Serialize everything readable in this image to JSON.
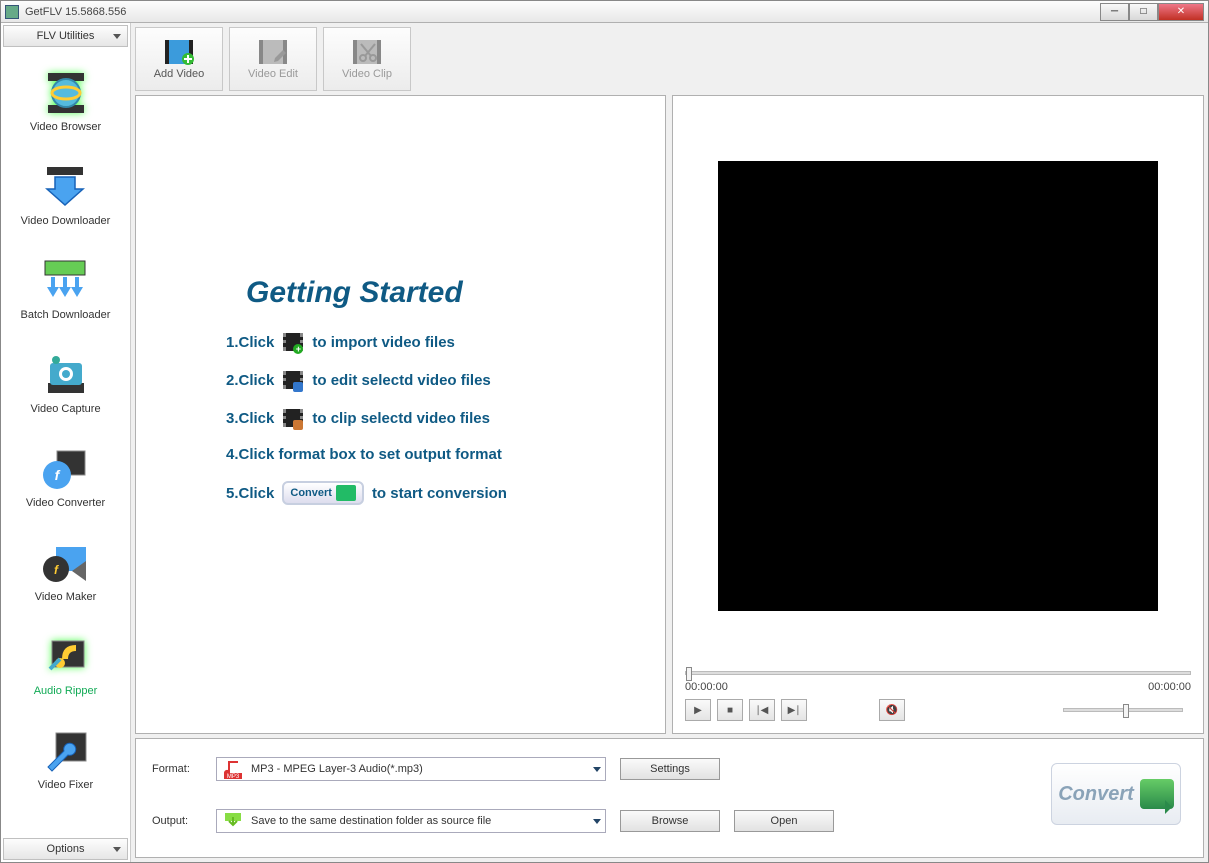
{
  "window": {
    "title": "GetFLV 15.5868.556"
  },
  "sidebar": {
    "header": "FLV Utilities",
    "footer": "Options",
    "items": [
      {
        "label": "Video Browser"
      },
      {
        "label": "Video Downloader"
      },
      {
        "label": "Batch Downloader"
      },
      {
        "label": "Video Capture"
      },
      {
        "label": "Video Converter"
      },
      {
        "label": "Video Maker"
      },
      {
        "label": "Audio Ripper"
      },
      {
        "label": "Video Fixer"
      }
    ]
  },
  "toolbar": {
    "add_video": "Add Video",
    "video_edit": "Video Edit",
    "video_clip": "Video Clip"
  },
  "getting_started": {
    "title": "Getting Started",
    "step1_a": "1.Click",
    "step1_b": "to import video files",
    "step2_a": "2.Click",
    "step2_b": "to edit selectd video files",
    "step3_a": "3.Click",
    "step3_b": "to clip selectd video files",
    "step4": "4.Click format box to set output format",
    "step5_a": "5.Click",
    "step5_badge": "Convert",
    "step5_b": "to start conversion"
  },
  "player": {
    "time_current": "00:00:00",
    "time_total": "00:00:00"
  },
  "bottom": {
    "format_label": "Format:",
    "format_value": "MP3 - MPEG Layer-3 Audio(*.mp3)",
    "output_label": "Output:",
    "output_value": "Save to the same destination folder as source file",
    "settings": "Settings",
    "browse": "Browse",
    "open": "Open",
    "convert": "Convert"
  }
}
